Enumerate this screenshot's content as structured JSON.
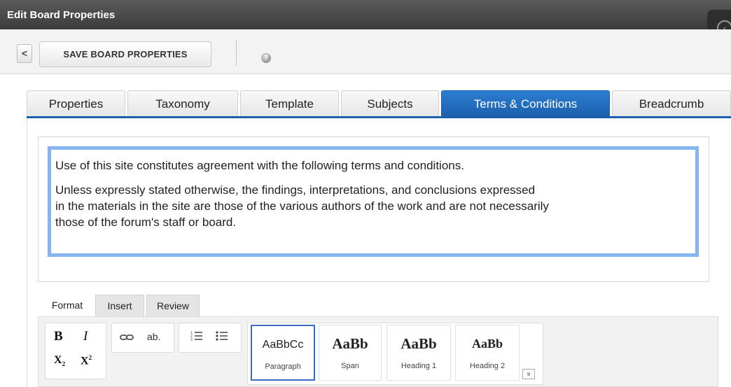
{
  "window": {
    "title": "Edit Board Properties"
  },
  "toolbar": {
    "back_glyph": "<",
    "save_label": "SAVE BOARD PROPERTIES",
    "help_glyph": "?"
  },
  "tabs": [
    {
      "label": "Properties",
      "active": false
    },
    {
      "label": "Taxonomy",
      "active": false
    },
    {
      "label": "Template",
      "active": false
    },
    {
      "label": "Subjects",
      "active": false
    },
    {
      "label": "Terms & Conditions",
      "active": true
    },
    {
      "label": "Breadcrumb",
      "active": false
    }
  ],
  "editor": {
    "paragraph_1": "Use of this site constitutes agreement with the following terms and conditions.",
    "paragraph_2_line_1": "Unless expressly stated otherwise, the findings, interpretations, and conclusions expressed",
    "paragraph_2_line_2": "in the materials in the site are those of the various authors of the work and are not necessarily",
    "paragraph_2_line_3": "those of the forum's staff or board."
  },
  "ribbon": {
    "tabs": [
      {
        "label": "Format",
        "active": true
      },
      {
        "label": "Insert",
        "active": false
      },
      {
        "label": "Review",
        "active": false
      }
    ],
    "font_group": {
      "bold": "B",
      "italic": "I",
      "subscript": "X",
      "subscript_mark": "2",
      "superscript": "X",
      "superscript_mark": "2"
    },
    "link_group": {
      "link_icon": "link-icon",
      "abbr": "ab."
    },
    "list_group": {
      "ordered_icon": "ordered-list-icon",
      "bullet_icon": "bullet-list-icon"
    },
    "styles": [
      {
        "sample": "AaBbCc",
        "caption": "Paragraph",
        "selected": true
      },
      {
        "sample": "AaBb",
        "caption": "Span",
        "selected": false
      },
      {
        "sample": "AaBb",
        "caption": "Heading 1",
        "selected": false
      },
      {
        "sample": "AaBb",
        "caption": "Heading 2",
        "selected": false
      }
    ],
    "more_glyph": "»"
  },
  "colors": {
    "titlebar": "#4a4a4a",
    "active_tab": "#2270c0",
    "editor_focus_border": "#84b5ee",
    "selected_style_border": "#3a6bc4"
  }
}
